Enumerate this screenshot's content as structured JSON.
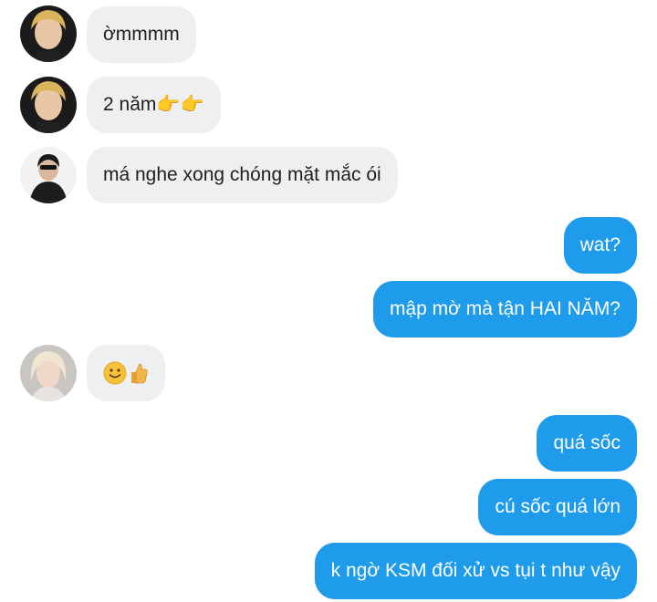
{
  "conversation": {
    "messages": [
      {
        "side": "incoming",
        "avatar": "avatar-1",
        "text": "ờmmmm"
      },
      {
        "side": "incoming",
        "avatar": "avatar-1",
        "text": "2 năm",
        "emoji": "👉👉"
      },
      {
        "side": "incoming",
        "avatar": "avatar-2",
        "text": "má nghe xong chóng mặt mắc ói"
      },
      {
        "side": "outgoing",
        "text": "wat?"
      },
      {
        "side": "outgoing",
        "text": "mập mờ mà tận HAI NĂM?"
      },
      {
        "side": "incoming",
        "avatar": "avatar-3",
        "emoji": "🙂👍"
      },
      {
        "side": "outgoing",
        "text": "quá sốc"
      },
      {
        "side": "outgoing",
        "text": "cú sốc quá lớn"
      },
      {
        "side": "outgoing",
        "text": "k ngờ KSM đối xử vs tụi t như vậy"
      }
    ]
  },
  "colors": {
    "incoming_bubble": "#eeeff1",
    "outgoing_bubble": "#1e9bea",
    "incoming_text": "#1f1f1f",
    "outgoing_text": "#ffffff"
  }
}
